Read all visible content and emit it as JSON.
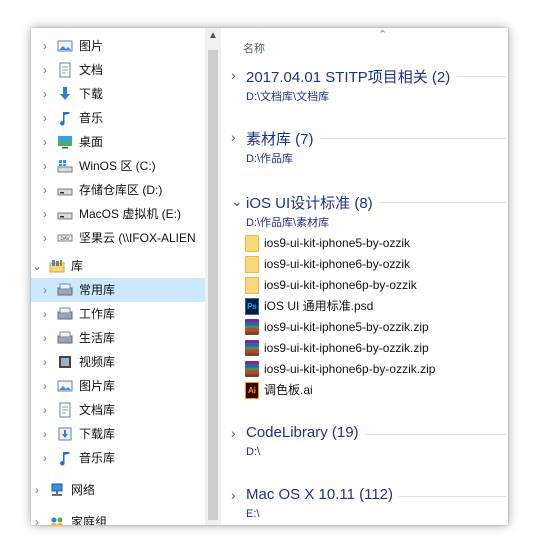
{
  "nav": {
    "items": [
      {
        "label": "图片",
        "icon": "pictures-icon",
        "indent": 1
      },
      {
        "label": "文档",
        "icon": "documents-icon",
        "indent": 1
      },
      {
        "label": "下载",
        "icon": "downloads-icon",
        "indent": 1
      },
      {
        "label": "音乐",
        "icon": "music-icon",
        "indent": 1
      },
      {
        "label": "桌面",
        "icon": "desktop-icon",
        "indent": 1
      },
      {
        "label": "WinOS 区 (C:)",
        "icon": "windows-drive-icon",
        "indent": 1
      },
      {
        "label": "存储仓库区 (D:)",
        "icon": "drive-icon",
        "indent": 1
      },
      {
        "label": "MacOS 虚拟机 (E:)",
        "icon": "drive-icon",
        "indent": 1
      },
      {
        "label": "坚果云 (\\\\IFOX-ALIEN",
        "icon": "network-drive-icon",
        "indent": 1
      },
      {
        "label": "库",
        "icon": "libraries-icon",
        "indent": 0,
        "expanded": true
      },
      {
        "label": "常用库",
        "icon": "library-icon",
        "indent": 1,
        "selected": true
      },
      {
        "label": "工作库",
        "icon": "library-icon",
        "indent": 1
      },
      {
        "label": "生活库",
        "icon": "library-icon",
        "indent": 1
      },
      {
        "label": "视频库",
        "icon": "video-library-icon",
        "indent": 1
      },
      {
        "label": "图片库",
        "icon": "pictures-library-icon",
        "indent": 1
      },
      {
        "label": "文档库",
        "icon": "documents-library-icon",
        "indent": 1
      },
      {
        "label": "下载库",
        "icon": "downloads-library-icon",
        "indent": 1
      },
      {
        "label": "音乐库",
        "icon": "music-library-icon",
        "indent": 1
      },
      {
        "label": "网络",
        "icon": "network-icon",
        "indent": 0
      },
      {
        "label": "家庭组",
        "icon": "homegroup-icon",
        "indent": 0
      }
    ]
  },
  "content": {
    "column_header": "名称",
    "groups": [
      {
        "title": "2017.04.01 STITP项目相关 (2)",
        "path": "D:\\文档库\\文档库",
        "expanded": false,
        "files": []
      },
      {
        "title": "素材库 (7)",
        "path": "D:\\作品库",
        "expanded": false,
        "files": []
      },
      {
        "title": "iOS UI设计标准 (8)",
        "path": "D:\\作品库\\素材库",
        "expanded": true,
        "files": [
          {
            "name": "ios9-ui-kit-iphone5-by-ozzik",
            "type": "folder"
          },
          {
            "name": "ios9-ui-kit-iphone6-by-ozzik",
            "type": "folder"
          },
          {
            "name": "ios9-ui-kit-iphone6p-by-ozzik",
            "type": "folder"
          },
          {
            "name": "iOS UI 通用标准.psd",
            "type": "psd"
          },
          {
            "name": "ios9-ui-kit-iphone5-by-ozzik.zip",
            "type": "zip"
          },
          {
            "name": "ios9-ui-kit-iphone6-by-ozzik.zip",
            "type": "zip"
          },
          {
            "name": "ios9-ui-kit-iphone6p-by-ozzik.zip",
            "type": "zip"
          },
          {
            "name": "调色板.ai",
            "type": "ai"
          }
        ]
      },
      {
        "title": "CodeLibrary (19)",
        "path": "D:\\",
        "expanded": false,
        "files": []
      },
      {
        "title": "Mac OS X 10.11 (112)",
        "path": "E:\\",
        "expanded": false,
        "files": []
      }
    ]
  },
  "colors": {
    "accent": "#1e3287",
    "selection": "#cce8ff",
    "folder": "#f8d878"
  }
}
